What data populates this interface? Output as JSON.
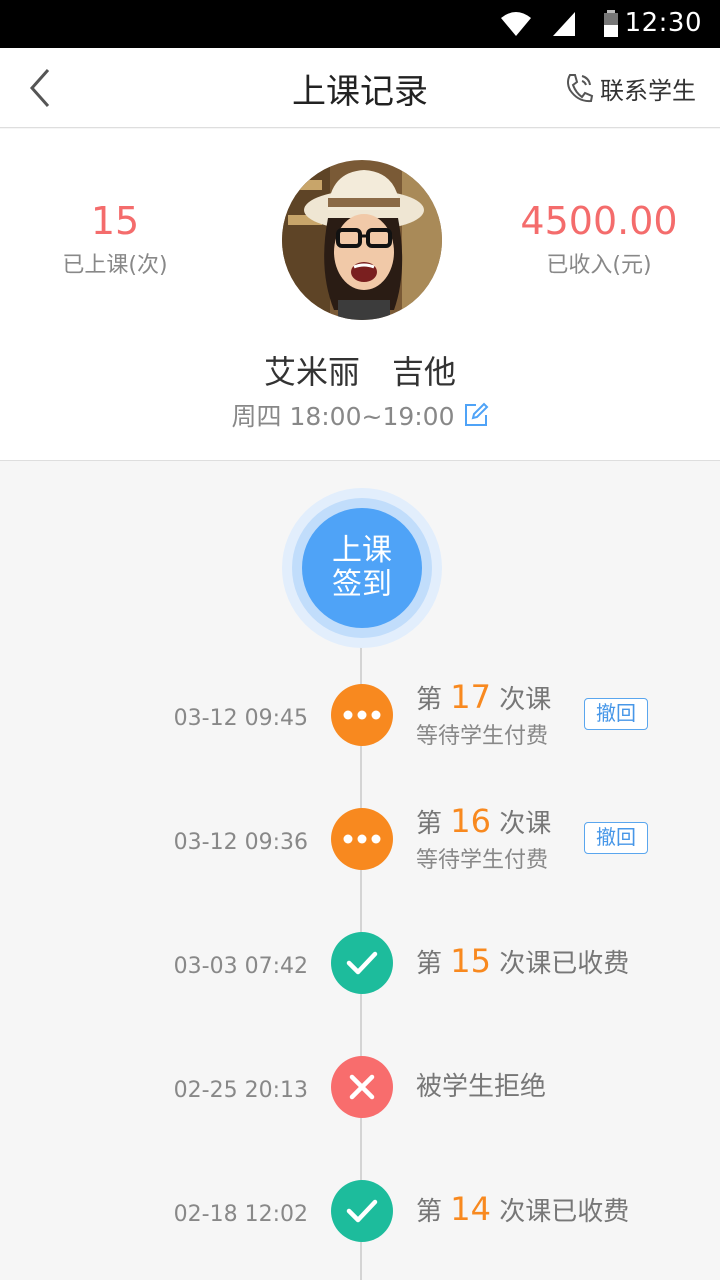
{
  "status_bar": {
    "time": "12:30"
  },
  "header": {
    "title": "上课记录",
    "contact_label": "联系学生"
  },
  "profile": {
    "lessons_count": "15",
    "lessons_label": "已上课(次)",
    "income": "4500.00",
    "income_label": "已收入(元)",
    "name": "艾米丽　吉他",
    "schedule": "周四 18:00~19:00"
  },
  "checkin": {
    "line1": "上课",
    "line2": "签到"
  },
  "records": [
    {
      "date": "03-12 09:45",
      "prefix": "第",
      "num": "17",
      "suffix": "次课",
      "sub": "等待学生付费",
      "action": "撤回",
      "status": "pending"
    },
    {
      "date": "03-12 09:36",
      "prefix": "第",
      "num": "16",
      "suffix": "次课",
      "sub": "等待学生付费",
      "action": "撤回",
      "status": "pending"
    },
    {
      "date": "03-03 07:42",
      "prefix": "第",
      "num": "15",
      "suffix": "次课已收费",
      "status": "paid"
    },
    {
      "date": "02-25 20:13",
      "text": "被学生拒绝",
      "status": "rejected"
    },
    {
      "date": "02-18 12:02",
      "prefix": "第",
      "num": "14",
      "suffix": "次课已收费",
      "status": "paid"
    }
  ],
  "colors": {
    "accent_blue": "#4fa3f7",
    "orange": "#f8891f",
    "green": "#1dbc9c",
    "red": "#f86d6d",
    "stat_red": "#f46c6c"
  }
}
